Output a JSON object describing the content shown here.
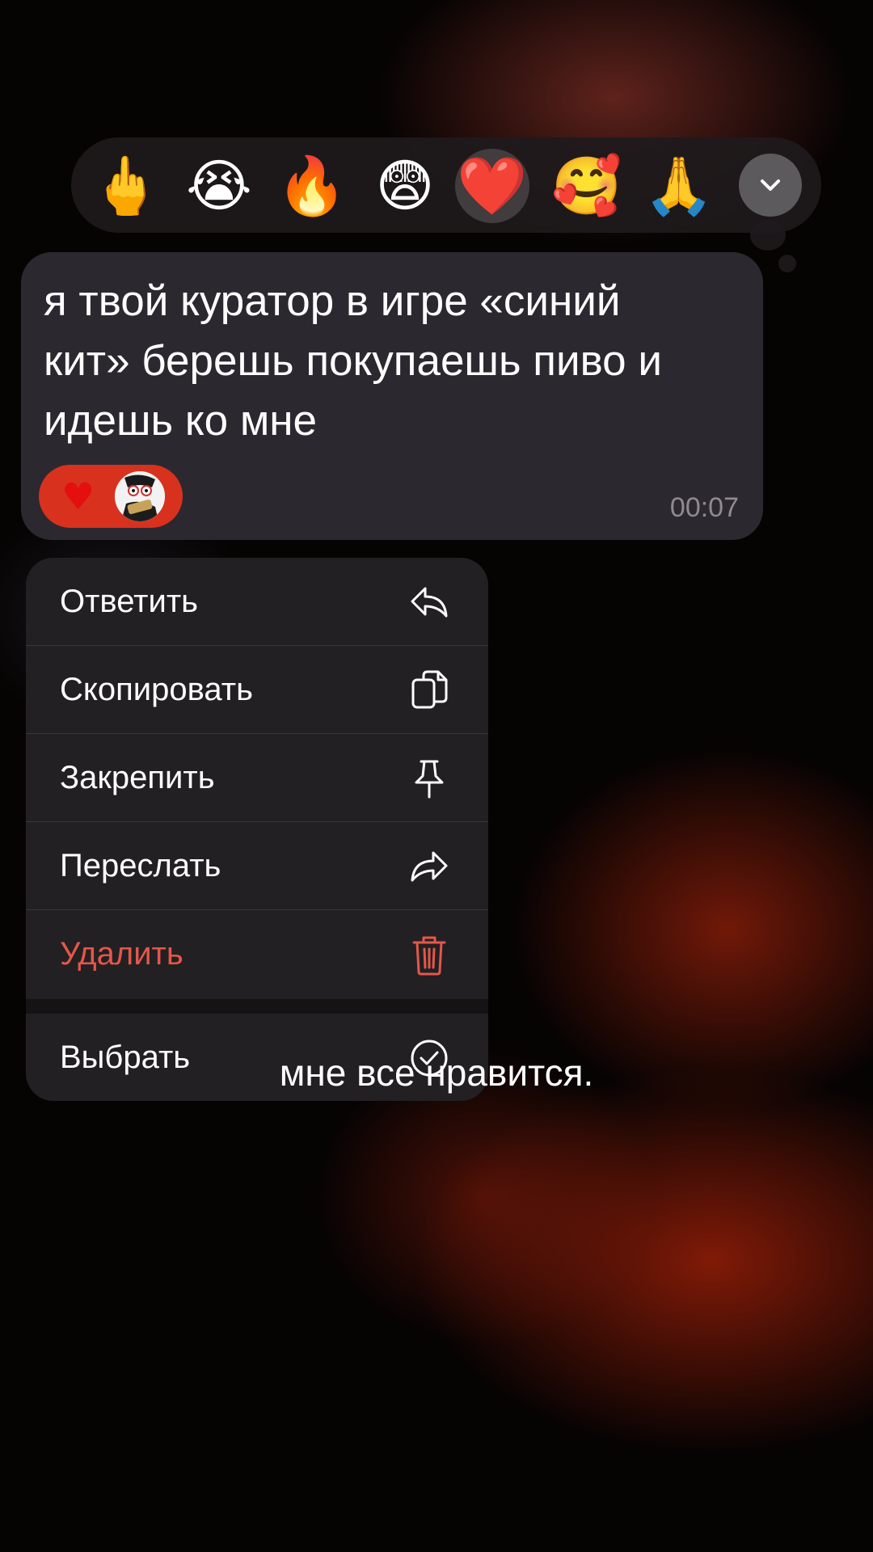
{
  "reactions": [
    {
      "emoji": "🖕",
      "icon": "middle-finger-emoji"
    },
    {
      "emoji": "😭",
      "icon": "crying-face-emoji"
    },
    {
      "emoji": "🔥",
      "icon": "fire-emoji"
    },
    {
      "emoji": "😨",
      "icon": "fearful-face-emoji"
    },
    {
      "emoji": "❤️",
      "icon": "red-heart-emoji",
      "selected": true
    },
    {
      "emoji": "🥰",
      "icon": "smiling-face-with-hearts-emoji"
    },
    {
      "emoji": "🙏",
      "icon": "folded-hands-emoji"
    }
  ],
  "message": {
    "text": "я твой куратор в игре «синий\nкит» берешь покупаешь пиво и\nидешь ко мне",
    "reaction": "♥",
    "time": "00:07"
  },
  "menu": {
    "items": [
      {
        "label": "Ответить",
        "icon": "reply-icon"
      },
      {
        "label": "Скопировать",
        "icon": "copy-icon"
      },
      {
        "label": "Закрепить",
        "icon": "pin-icon"
      },
      {
        "label": "Переслать",
        "icon": "forward-icon"
      },
      {
        "label": "Удалить",
        "icon": "trash-icon",
        "danger": true
      },
      {
        "label": "Выбрать",
        "icon": "check-circle-icon"
      }
    ]
  },
  "caption": "мне все нравится.",
  "colors": {
    "accent_red": "#d8321e",
    "danger": "#e4574a",
    "bubble": "#2c2830",
    "menu": "#222022"
  }
}
